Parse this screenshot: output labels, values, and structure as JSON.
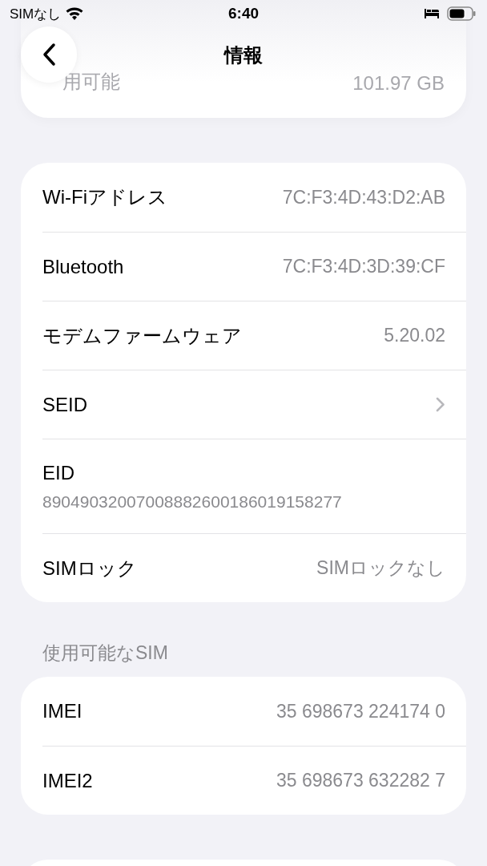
{
  "status_bar": {
    "carrier": "SIMなし",
    "time": "6:40"
  },
  "nav": {
    "title": "情報"
  },
  "faded_row": {
    "label": "用可能",
    "value": "101.97 GB"
  },
  "groups": [
    {
      "rows": [
        {
          "kind": "value",
          "label": "Wi-Fiアドレス",
          "value": "7C:F3:4D:43:D2:AB"
        },
        {
          "kind": "value",
          "label": "Bluetooth",
          "value": "7C:F3:4D:3D:39:CF"
        },
        {
          "kind": "value",
          "label": "モデムファームウェア",
          "value": "5.20.02"
        },
        {
          "kind": "chevron",
          "label": "SEID"
        },
        {
          "kind": "stacked",
          "label": "EID",
          "value": "89049032007008882600186019158277"
        },
        {
          "kind": "value",
          "label": "SIMロック",
          "value": "SIMロックなし"
        }
      ]
    },
    {
      "header": "使用可能なSIM",
      "rows": [
        {
          "kind": "value",
          "label": "IMEI",
          "value": "35 698673 224174 0"
        },
        {
          "kind": "value",
          "label": "IMEI2",
          "value": "35 698673 632282 7"
        }
      ]
    }
  ]
}
